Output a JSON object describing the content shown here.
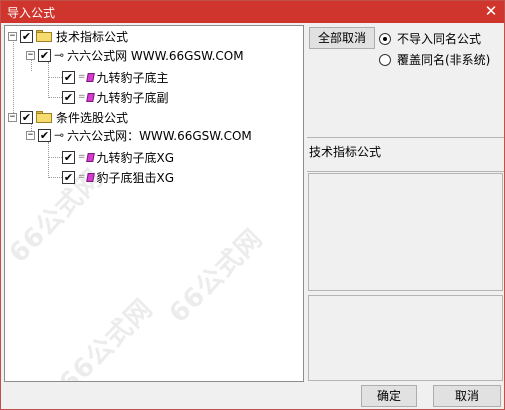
{
  "window": {
    "title": "导入公式",
    "close_glyph": "✕"
  },
  "tree": {
    "items": [
      {
        "id": "root1",
        "label": "技术指标公式",
        "kind": "folder",
        "checked": true,
        "expander": "−"
      },
      {
        "id": "src1",
        "label": "六六公式网 WWW.66GSW.COM",
        "kind": "source",
        "checked": true,
        "expander": "−"
      },
      {
        "id": "f1",
        "label": "九转豹子底主",
        "kind": "formula",
        "checked": true
      },
      {
        "id": "f2",
        "label": "九转豹子底副",
        "kind": "formula",
        "checked": true
      },
      {
        "id": "root2",
        "label": "条件选股公式",
        "kind": "folder",
        "checked": true,
        "expander": "−"
      },
      {
        "id": "src2",
        "label": "六六公式网：WWW.66GSW.COM",
        "kind": "source",
        "checked": true,
        "expander": "−"
      },
      {
        "id": "f3",
        "label": "九转豹子底XG",
        "kind": "formula",
        "checked": true
      },
      {
        "id": "f4",
        "label": "豹子底狙击XG",
        "kind": "formula",
        "checked": true
      }
    ],
    "check_glyph": "✔",
    "watermark": "66公式网"
  },
  "options": {
    "cancel_all_label": "全部取消",
    "radio_options": [
      {
        "label": "不导入同名公式",
        "selected": true
      },
      {
        "label": "覆盖同名(非系统)",
        "selected": false
      }
    ]
  },
  "info": {
    "category_label": "技术指标公式"
  },
  "footer": {
    "ok_label": "确定",
    "cancel_label": "取消"
  },
  "colors": {
    "titlebar": "#d0352d",
    "window_bg": "#f0f0f0",
    "formula_icon": "#d63ad0"
  },
  "icons": {
    "folder": "folder-icon",
    "source": "key-icon",
    "formula": "formula-icon",
    "close": "close-icon"
  }
}
